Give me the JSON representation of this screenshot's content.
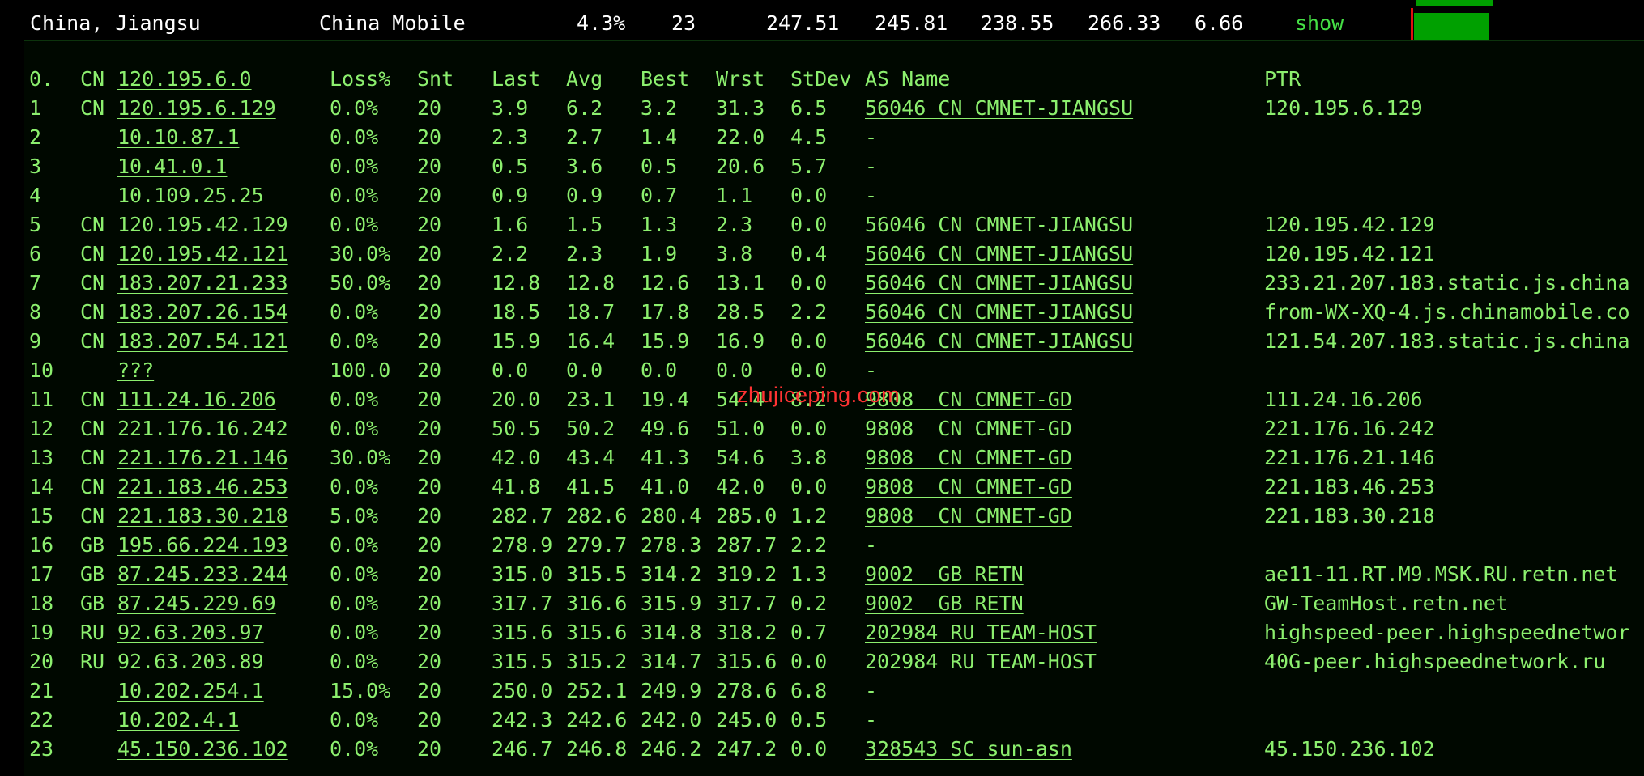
{
  "summary": {
    "location": "China, Jiangsu",
    "isp": "China Mobile",
    "loss": "4.3%",
    "hops": "23",
    "last": "247.51",
    "avg": "245.81",
    "best": "238.55",
    "worst": "266.33",
    "stdev": "6.66",
    "show_label": "show"
  },
  "columns": {
    "index": "0.",
    "cc": "CN",
    "host": "120.195.6.0",
    "loss": "Loss%",
    "snt": "Snt",
    "last": "Last",
    "avg": "Avg",
    "best": "Best",
    "wrst": "Wrst",
    "stdev": "StDev",
    "as_name": "AS Name",
    "ptr": "PTR"
  },
  "hops": [
    {
      "n": "1",
      "cc": "CN",
      "host": "120.195.6.129",
      "loss": "0.0%",
      "snt": "20",
      "last": "3.9",
      "avg": "6.2",
      "best": "3.2",
      "wrst": "31.3",
      "stdev": "6.5",
      "as": "56046 CN CMNET-JIANGSU",
      "ptr": "120.195.6.129"
    },
    {
      "n": "2",
      "cc": "",
      "host": "10.10.87.1",
      "loss": "0.0%",
      "snt": "20",
      "last": "2.3",
      "avg": "2.7",
      "best": "1.4",
      "wrst": "22.0",
      "stdev": "4.5",
      "as": "-",
      "ptr": ""
    },
    {
      "n": "3",
      "cc": "",
      "host": "10.41.0.1",
      "loss": "0.0%",
      "snt": "20",
      "last": "0.5",
      "avg": "3.6",
      "best": "0.5",
      "wrst": "20.6",
      "stdev": "5.7",
      "as": "-",
      "ptr": ""
    },
    {
      "n": "4",
      "cc": "",
      "host": "10.109.25.25",
      "loss": "0.0%",
      "snt": "20",
      "last": "0.9",
      "avg": "0.9",
      "best": "0.7",
      "wrst": "1.1",
      "stdev": "0.0",
      "as": "-",
      "ptr": ""
    },
    {
      "n": "5",
      "cc": "CN",
      "host": "120.195.42.129",
      "loss": "0.0%",
      "snt": "20",
      "last": "1.6",
      "avg": "1.5",
      "best": "1.3",
      "wrst": "2.3",
      "stdev": "0.0",
      "as": "56046 CN CMNET-JIANGSU",
      "ptr": "120.195.42.129"
    },
    {
      "n": "6",
      "cc": "CN",
      "host": "120.195.42.121",
      "loss": "30.0%",
      "snt": "20",
      "last": "2.2",
      "avg": "2.3",
      "best": "1.9",
      "wrst": "3.8",
      "stdev": "0.4",
      "as": "56046 CN CMNET-JIANGSU",
      "ptr": "120.195.42.121"
    },
    {
      "n": "7",
      "cc": "CN",
      "host": "183.207.21.233",
      "loss": "50.0%",
      "snt": "20",
      "last": "12.8",
      "avg": "12.8",
      "best": "12.6",
      "wrst": "13.1",
      "stdev": "0.0",
      "as": "56046 CN CMNET-JIANGSU",
      "ptr": "233.21.207.183.static.js.china"
    },
    {
      "n": "8",
      "cc": "CN",
      "host": "183.207.26.154",
      "loss": "0.0%",
      "snt": "20",
      "last": "18.5",
      "avg": "18.7",
      "best": "17.8",
      "wrst": "28.5",
      "stdev": "2.2",
      "as": "56046 CN CMNET-JIANGSU",
      "ptr": "from-WX-XQ-4.js.chinamobile.co"
    },
    {
      "n": "9",
      "cc": "CN",
      "host": "183.207.54.121",
      "loss": "0.0%",
      "snt": "20",
      "last": "15.9",
      "avg": "16.4",
      "best": "15.9",
      "wrst": "16.9",
      "stdev": "0.0",
      "as": "56046 CN CMNET-JIANGSU",
      "ptr": "121.54.207.183.static.js.china"
    },
    {
      "n": "10",
      "cc": "",
      "host": "???",
      "loss": "100.0",
      "snt": "20",
      "last": "0.0",
      "avg": "0.0",
      "best": "0.0",
      "wrst": "0.0",
      "stdev": "0.0",
      "as": "-",
      "ptr": ""
    },
    {
      "n": "11",
      "cc": "CN",
      "host": "111.24.16.206",
      "loss": "0.0%",
      "snt": "20",
      "last": "20.0",
      "avg": "23.1",
      "best": "19.4",
      "wrst": "54.4",
      "stdev": "8.2",
      "as": "9808  CN CMNET-GD",
      "ptr": "111.24.16.206"
    },
    {
      "n": "12",
      "cc": "CN",
      "host": "221.176.16.242",
      "loss": "0.0%",
      "snt": "20",
      "last": "50.5",
      "avg": "50.2",
      "best": "49.6",
      "wrst": "51.0",
      "stdev": "0.0",
      "as": "9808  CN CMNET-GD",
      "ptr": "221.176.16.242"
    },
    {
      "n": "13",
      "cc": "CN",
      "host": "221.176.21.146",
      "loss": "30.0%",
      "snt": "20",
      "last": "42.0",
      "avg": "43.4",
      "best": "41.3",
      "wrst": "54.6",
      "stdev": "3.8",
      "as": "9808  CN CMNET-GD",
      "ptr": "221.176.21.146"
    },
    {
      "n": "14",
      "cc": "CN",
      "host": "221.183.46.253",
      "loss": "0.0%",
      "snt": "20",
      "last": "41.8",
      "avg": "41.5",
      "best": "41.0",
      "wrst": "42.0",
      "stdev": "0.0",
      "as": "9808  CN CMNET-GD",
      "ptr": "221.183.46.253"
    },
    {
      "n": "15",
      "cc": "CN",
      "host": "221.183.30.218",
      "loss": "5.0%",
      "snt": "20",
      "last": "282.7",
      "avg": "282.6",
      "best": "280.4",
      "wrst": "285.0",
      "stdev": "1.2",
      "as": "9808  CN CMNET-GD",
      "ptr": "221.183.30.218"
    },
    {
      "n": "16",
      "cc": "GB",
      "host": "195.66.224.193",
      "loss": "0.0%",
      "snt": "20",
      "last": "278.9",
      "avg": "279.7",
      "best": "278.3",
      "wrst": "287.7",
      "stdev": "2.2",
      "as": "-",
      "ptr": ""
    },
    {
      "n": "17",
      "cc": "GB",
      "host": "87.245.233.244",
      "loss": "0.0%",
      "snt": "20",
      "last": "315.0",
      "avg": "315.5",
      "best": "314.2",
      "wrst": "319.2",
      "stdev": "1.3",
      "as": "9002  GB RETN",
      "ptr": "ae11-11.RT.M9.MSK.RU.retn.net"
    },
    {
      "n": "18",
      "cc": "GB",
      "host": "87.245.229.69",
      "loss": "0.0%",
      "snt": "20",
      "last": "317.7",
      "avg": "316.6",
      "best": "315.9",
      "wrst": "317.7",
      "stdev": "0.2",
      "as": "9002  GB RETN",
      "ptr": "GW-TeamHost.retn.net"
    },
    {
      "n": "19",
      "cc": "RU",
      "host": "92.63.203.97",
      "loss": "0.0%",
      "snt": "20",
      "last": "315.6",
      "avg": "315.6",
      "best": "314.8",
      "wrst": "318.2",
      "stdev": "0.7",
      "as": "202984 RU TEAM-HOST",
      "ptr": "highspeed-peer.highspeednetwor"
    },
    {
      "n": "20",
      "cc": "RU",
      "host": "92.63.203.89",
      "loss": "0.0%",
      "snt": "20",
      "last": "315.5",
      "avg": "315.2",
      "best": "314.7",
      "wrst": "315.6",
      "stdev": "0.0",
      "as": "202984 RU TEAM-HOST",
      "ptr": "40G-peer.highspeednetwork.ru"
    },
    {
      "n": "21",
      "cc": "",
      "host": "10.202.254.1",
      "loss": "15.0%",
      "snt": "20",
      "last": "250.0",
      "avg": "252.1",
      "best": "249.9",
      "wrst": "278.6",
      "stdev": "6.8",
      "as": "-",
      "ptr": ""
    },
    {
      "n": "22",
      "cc": "",
      "host": "10.202.4.1",
      "loss": "0.0%",
      "snt": "20",
      "last": "242.3",
      "avg": "242.6",
      "best": "242.0",
      "wrst": "245.0",
      "stdev": "0.5",
      "as": "-",
      "ptr": ""
    },
    {
      "n": "23",
      "cc": "",
      "host": "45.150.236.102",
      "loss": "0.0%",
      "snt": "20",
      "last": "246.7",
      "avg": "246.8",
      "best": "246.2",
      "wrst": "247.2",
      "stdev": "0.0",
      "as": "328543 SC sun-asn",
      "ptr": "45.150.236.102"
    }
  ],
  "watermark": "zhujiceping.com",
  "colors": {
    "text": "#8cef6e",
    "background": "#000800",
    "accent_bar": "#00a000",
    "marker": "#e01010",
    "watermark": "#ff3333"
  }
}
